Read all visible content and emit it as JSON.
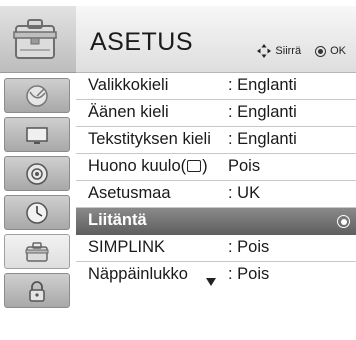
{
  "menu": {
    "title": "ASETUS",
    "hint_move": "Siirrä",
    "hint_ok": "OK"
  },
  "rail": [
    {
      "icon": "satellite-icon"
    },
    {
      "icon": "screen-icon"
    },
    {
      "icon": "speaker-icon"
    },
    {
      "icon": "clock-icon"
    },
    {
      "icon": "toolbox-icon",
      "active": true
    },
    {
      "icon": "padlock-icon"
    }
  ],
  "items": [
    {
      "label": "Valikkokieli",
      "value": ": Englanti"
    },
    {
      "label": "Äänen kieli",
      "value": ": Englanti"
    },
    {
      "label": "Tekstityksen kieli",
      "value": ": Englanti"
    },
    {
      "label": "Huono kuulo(",
      "label_suffix": ")",
      "value": "Pois"
    },
    {
      "label": "Asetusmaa",
      "value": ": UK"
    },
    {
      "label": "Liitäntä",
      "value": ""
    },
    {
      "label": "SIMPLINK",
      "value": ": Pois"
    },
    {
      "label": "Näppäinlukko",
      "value": ": Pois"
    }
  ],
  "selected_index": 5
}
